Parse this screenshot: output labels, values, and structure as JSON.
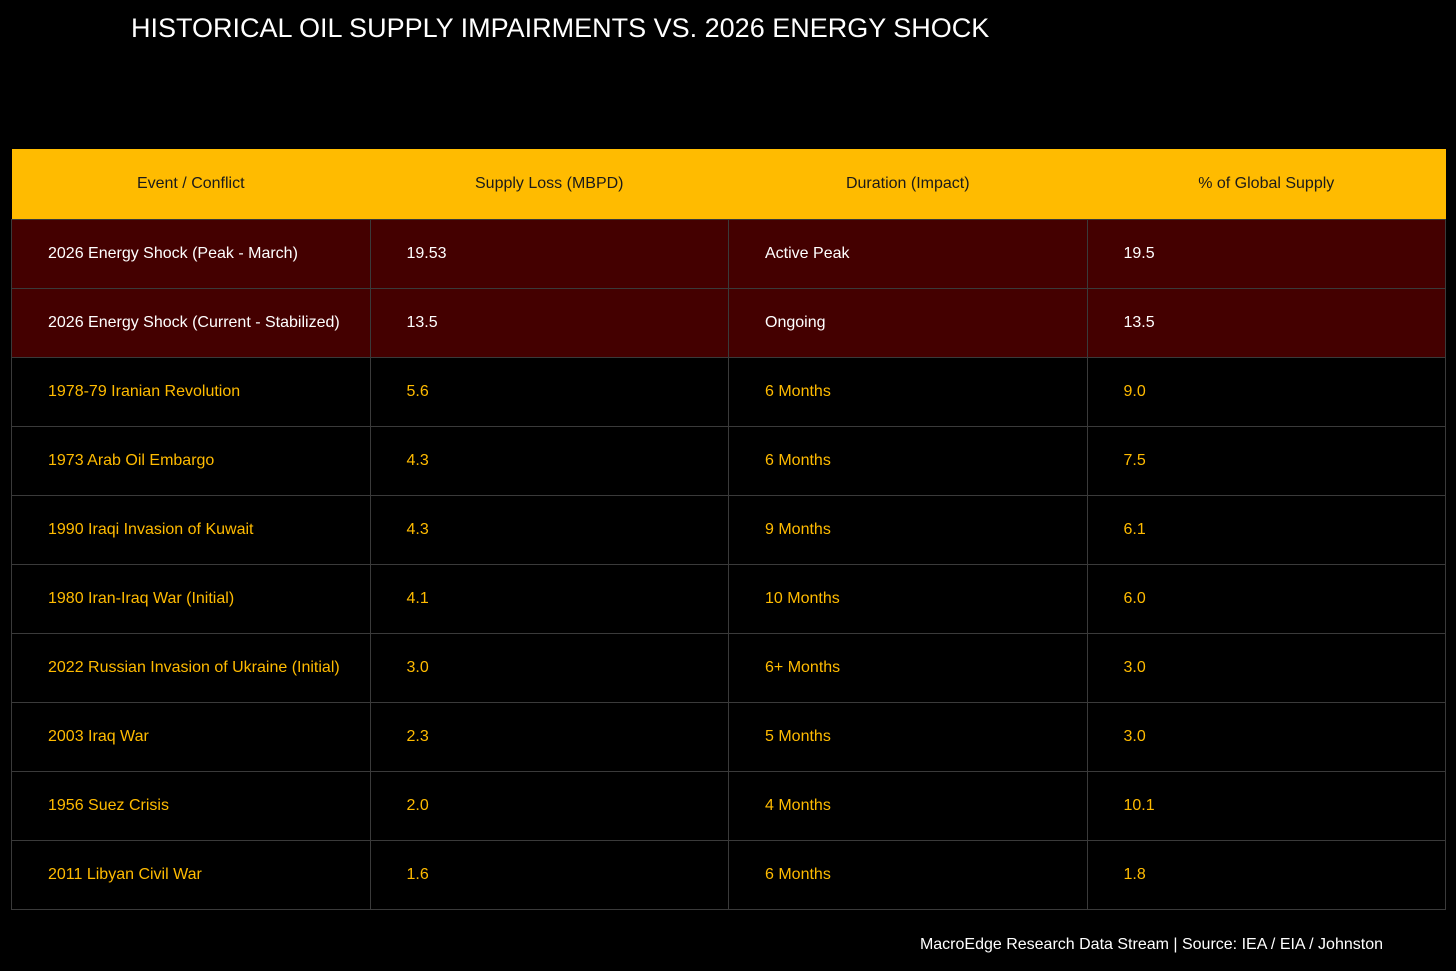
{
  "title": "HISTORICAL OIL SUPPLY IMPAIRMENTS VS. 2026 ENERGY SHOCK",
  "source": "MacroEdge Research Data Stream | Source: IEA / EIA / Johnston",
  "colors": {
    "header_bg": "#ffbb00",
    "current_row_bg": "#440000",
    "historical_text": "#ffbb00",
    "background": "#000000"
  },
  "chart_data": {
    "type": "table",
    "columns": [
      "Event / Conflict",
      "Supply Loss (MBPD)",
      "Duration (Impact)",
      "% of Global Supply"
    ],
    "rows": [
      {
        "event": "2026 Energy Shock (Peak - March)",
        "supply_loss": "19.53",
        "duration": "Active Peak",
        "pct_global": "19.5",
        "highlight": true
      },
      {
        "event": "2026 Energy Shock (Current - Stabilized)",
        "supply_loss": "13.5",
        "duration": "Ongoing",
        "pct_global": "13.5",
        "highlight": true
      },
      {
        "event": "1978-79 Iranian Revolution",
        "supply_loss": "5.6",
        "duration": "6 Months",
        "pct_global": "9.0",
        "highlight": false
      },
      {
        "event": "1973 Arab Oil Embargo",
        "supply_loss": "4.3",
        "duration": "6 Months",
        "pct_global": "7.5",
        "highlight": false
      },
      {
        "event": "1990 Iraqi Invasion of Kuwait",
        "supply_loss": "4.3",
        "duration": "9 Months",
        "pct_global": "6.1",
        "highlight": false
      },
      {
        "event": "1980 Iran-Iraq War (Initial)",
        "supply_loss": "4.1",
        "duration": "10 Months",
        "pct_global": "6.0",
        "highlight": false
      },
      {
        "event": "2022 Russian Invasion of Ukraine (Initial)",
        "supply_loss": "3.0",
        "duration": "6+ Months",
        "pct_global": "3.0",
        "highlight": false
      },
      {
        "event": "2003 Iraq War",
        "supply_loss": "2.3",
        "duration": "5 Months",
        "pct_global": "3.0",
        "highlight": false
      },
      {
        "event": "1956 Suez Crisis",
        "supply_loss": "2.0",
        "duration": "4 Months",
        "pct_global": "10.1",
        "highlight": false
      },
      {
        "event": "2011 Libyan Civil War",
        "supply_loss": "1.6",
        "duration": "6 Months",
        "pct_global": "1.8",
        "highlight": false
      }
    ]
  }
}
